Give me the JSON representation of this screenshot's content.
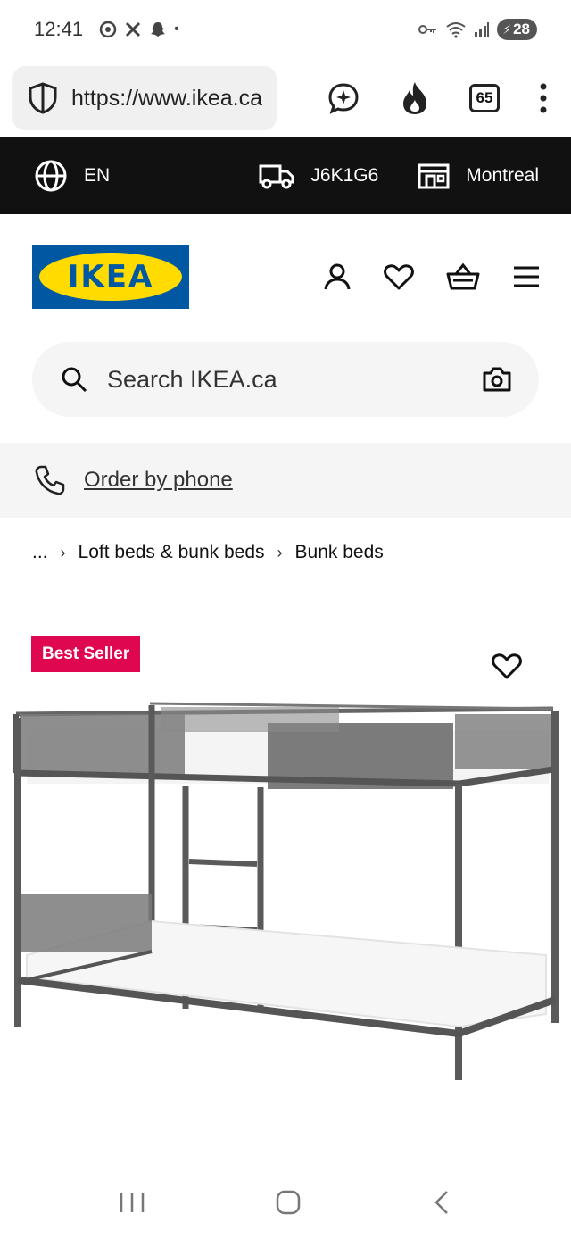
{
  "status_bar": {
    "time": "12:41",
    "battery": "28",
    "dot": "•"
  },
  "browser": {
    "url": "https://www.ikea.ca",
    "tab_count": "65",
    "icons": [
      "shield-icon",
      "chat-sparkle-icon",
      "flame-icon",
      "tabs-icon",
      "more-icon"
    ]
  },
  "top_bar": {
    "language": "EN",
    "postal_code": "J6K1G6",
    "store": "Montreal"
  },
  "header": {
    "logo_text": "IKEA",
    "colors": {
      "logo_blue": "#0058a3",
      "logo_yellow": "#ffdb00"
    }
  },
  "search": {
    "placeholder": "Search IKEA.ca"
  },
  "phone": {
    "label": "Order by phone"
  },
  "breadcrumb": {
    "ellipsis": "...",
    "items": [
      "Loft beds & bunk beds",
      "Bunk beds"
    ]
  },
  "product": {
    "badge": "Best Seller",
    "badge_color": "#e00751"
  }
}
